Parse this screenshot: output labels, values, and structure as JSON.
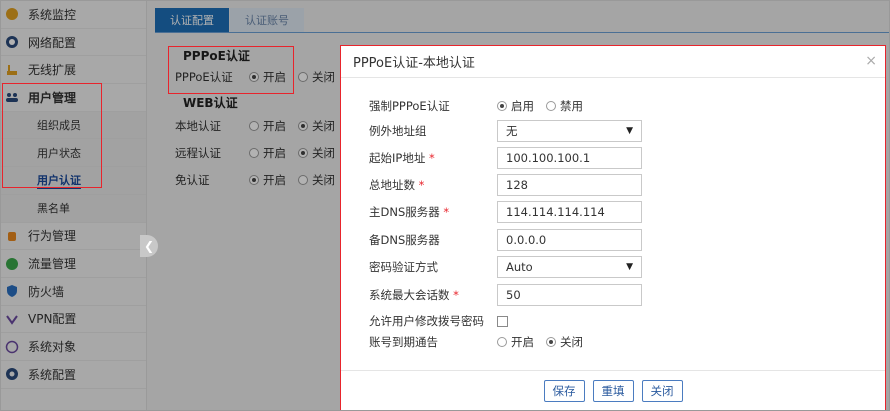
{
  "sidebar": {
    "items": [
      {
        "label": "系统监控",
        "icon": "monitor-icon"
      },
      {
        "label": "网络配置",
        "icon": "network-icon"
      },
      {
        "label": "无线扩展",
        "icon": "wireless-icon"
      },
      {
        "label": "用户管理",
        "icon": "users-icon"
      },
      {
        "label": "行为管理",
        "icon": "hand-icon"
      },
      {
        "label": "流量管理",
        "icon": "traffic-icon"
      },
      {
        "label": "防火墙",
        "icon": "shield-icon"
      },
      {
        "label": "VPN配置",
        "icon": "vpn-icon"
      },
      {
        "label": "系统对象",
        "icon": "object-icon"
      },
      {
        "label": "系统配置",
        "icon": "gear-icon"
      }
    ],
    "user_sub": [
      "组织成员",
      "用户状态",
      "用户认证",
      "黑名单"
    ]
  },
  "main": {
    "tabs": [
      "认证配置",
      "认证账号"
    ],
    "pppoe": {
      "title": "PPPoE认证",
      "label": "PPPoE认证",
      "on": "开启",
      "off": "关闭"
    },
    "web": {
      "title": "WEB认证",
      "rows": [
        {
          "label": "本地认证",
          "on": "开启",
          "off": "关闭"
        },
        {
          "label": "远程认证",
          "on": "开启",
          "off": "关闭"
        },
        {
          "label": "免认证",
          "on": "开启",
          "off": "关闭"
        }
      ]
    }
  },
  "dialog": {
    "title": "PPPoE认证-本地认证",
    "close_icon": "×",
    "force": {
      "label": "强制PPPoE认证",
      "enable": "启用",
      "disable": "禁用"
    },
    "exception_group": {
      "label": "例外地址组",
      "value": "无"
    },
    "start_ip": {
      "label": "起始IP地址",
      "value": "100.100.100.1"
    },
    "total": {
      "label": "总地址数",
      "value": "128"
    },
    "primary_dns": {
      "label": "主DNS服务器",
      "value": "114.114.114.114"
    },
    "secondary_dns": {
      "label": "备DNS服务器",
      "value": "0.0.0.0"
    },
    "auth_method": {
      "label": "密码验证方式",
      "value": "Auto"
    },
    "max_sessions": {
      "label": "系统最大会话数",
      "value": "50"
    },
    "allow_change": {
      "label": "允许用户修改拨号密码"
    },
    "expire_notice": {
      "label": "账号到期通告",
      "on": "开启",
      "off": "关闭"
    },
    "buttons": {
      "save": "保存",
      "reset": "重填",
      "close": "关闭"
    }
  },
  "colors": {
    "accent": "#1e6fb8",
    "highlight": "#e8242c"
  }
}
